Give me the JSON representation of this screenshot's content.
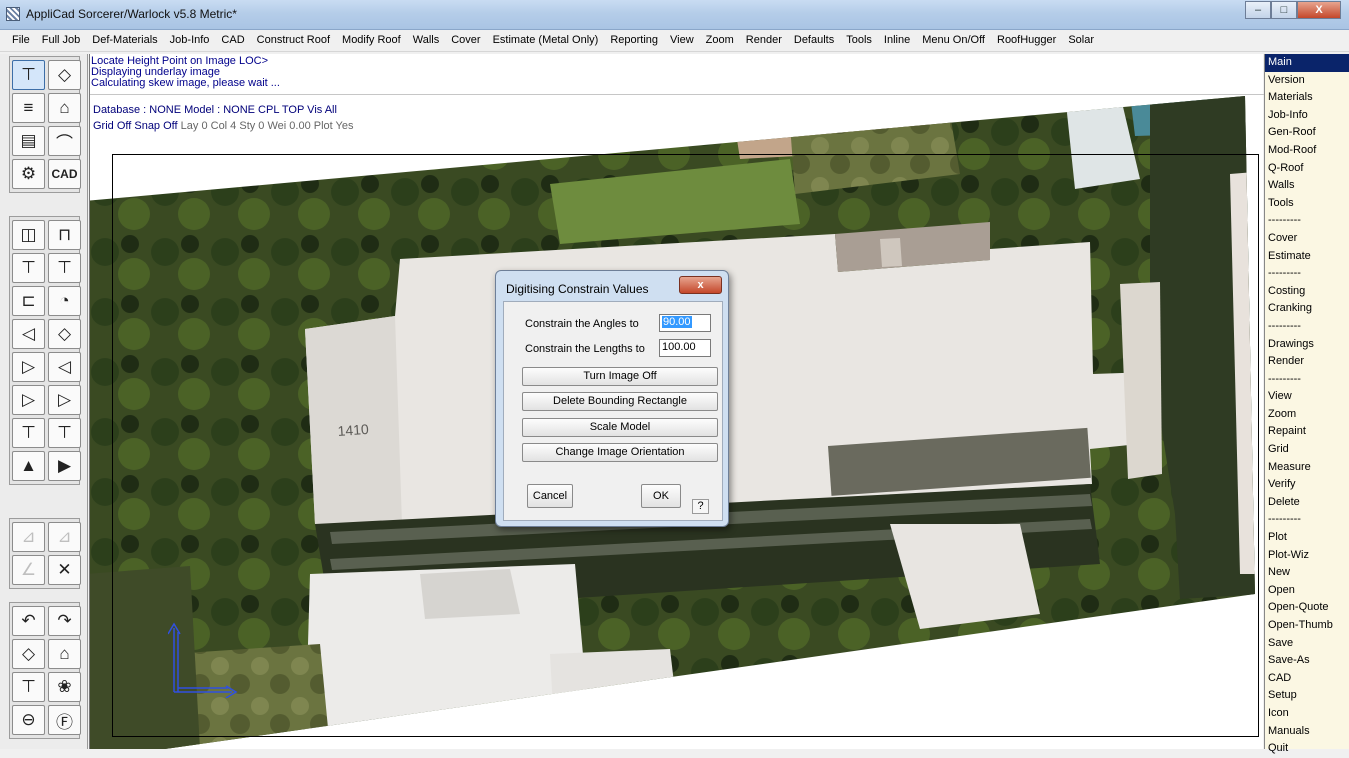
{
  "window": {
    "title": "AppliCad Sorcerer/Warlock v5.8 Metric*",
    "min_icon": "minimize-icon",
    "max_icon": "maximize-icon",
    "close_label": "X"
  },
  "menubar": [
    "File",
    "Full Job",
    "Def-Materials",
    "Job-Info",
    "CAD",
    "Construct Roof",
    "Modify Roof",
    "Walls",
    "Cover",
    "Estimate (Metal Only)",
    "Reporting",
    "View",
    "Zoom",
    "Render",
    "Defaults",
    "Tools",
    "Inline",
    "Menu On/Off",
    "RoofHugger",
    "Solar"
  ],
  "status": {
    "line1": "Locate Height Point on Image LOC>",
    "line2": "Displaying underlay image",
    "line3": "Calculating skew image, please wait ..."
  },
  "info": {
    "line1": "Database : NONE  Model : NONE  CPL TOP  Vis All",
    "grid": "Grid Off  Snap Off",
    "props": "Lay 0   Col 4   Sty 0   Wei 0.00   Plot Yes"
  },
  "toolbar": {
    "cad_label": "CAD",
    "groups": [
      [
        {
          "icon": "roof-plan-icon",
          "sym": "⊤",
          "on": true
        },
        {
          "icon": "roof-3d-icon",
          "sym": "◇"
        },
        {
          "icon": "gable-icon",
          "sym": "≡"
        },
        {
          "icon": "roof-tool-icon",
          "sym": "⌂"
        },
        {
          "icon": "copy-roof-icon",
          "sym": "▤"
        },
        {
          "icon": "hip-icon",
          "sym": "⌒"
        },
        {
          "icon": "wrench-icon",
          "sym": "⚙"
        },
        {
          "icon": "cad-icon",
          "sym": "CAD",
          "text": true
        }
      ],
      [
        {
          "icon": "wall-icon",
          "sym": "◫"
        },
        {
          "icon": "bracket-icon",
          "sym": "⊓"
        },
        {
          "icon": "roof-frame-icon",
          "sym": "⊤"
        },
        {
          "icon": "roof-corner-icon",
          "sym": "⊤"
        },
        {
          "icon": "flashing-icon",
          "sym": "⊏"
        },
        {
          "icon": "dial-icon",
          "sym": "◔"
        },
        {
          "icon": "hip-left-icon",
          "sym": "◁"
        },
        {
          "icon": "diamond-icon",
          "sym": "◇"
        },
        {
          "icon": "sheet-icon",
          "sym": "▷"
        },
        {
          "icon": "fold-icon",
          "sym": "◁"
        },
        {
          "icon": "sheets-left-icon",
          "sym": "▷"
        },
        {
          "icon": "sheets-right-icon",
          "sym": "▷"
        },
        {
          "icon": "frame-icon",
          "sym": "⊤"
        },
        {
          "icon": "truss-icon",
          "sym": "⊤"
        },
        {
          "icon": "stamp-icon",
          "sym": "▲"
        },
        {
          "icon": "ridge-icon",
          "sym": "▶"
        }
      ],
      [
        {
          "icon": "dim-line-icon",
          "sym": "⊿",
          "dim": true
        },
        {
          "icon": "dim-angle-icon",
          "sym": "⊿",
          "dim": true
        },
        {
          "icon": "parallel-icon",
          "sym": "∠",
          "dim": true
        },
        {
          "icon": "delete-x-icon",
          "sym": "✕"
        }
      ],
      [
        {
          "icon": "undo-icon",
          "sym": "↶"
        },
        {
          "icon": "redo-icon",
          "sym": "↷"
        },
        {
          "icon": "roof-view-icon",
          "sym": "◇"
        },
        {
          "icon": "paint-brush-icon",
          "sym": "⌂"
        },
        {
          "icon": "roof-plan2-icon",
          "sym": "⊤"
        },
        {
          "icon": "flower-icon",
          "sym": "❀"
        },
        {
          "icon": "zoom-out-icon",
          "sym": "⊖"
        },
        {
          "icon": "f-circle-icon",
          "sym": "Ⓕ"
        }
      ]
    ]
  },
  "sidebar": [
    "Main",
    "Version",
    "Materials",
    "Job-Info",
    "Gen-Roof",
    "Mod-Roof",
    "Q-Roof",
    "Walls",
    "Tools",
    "---------",
    "Cover",
    "Estimate",
    "---------",
    "Costing",
    "Cranking",
    "---------",
    "Drawings",
    "Render",
    "---------",
    "View",
    "Zoom",
    "Repaint",
    "Grid",
    "Measure",
    "Verify",
    "Delete",
    "---------",
    "Plot",
    "Plot-Wiz",
    "New",
    "Open",
    "Open-Quote",
    "Open-Thumb",
    "Save",
    "Save-As",
    "CAD",
    "Setup",
    "Icon",
    "Manuals",
    "Quit"
  ],
  "dialog": {
    "title": "Digitising Constrain Values",
    "close_label": "x",
    "angles_label": "Constrain the Angles to",
    "angles_value": "90.00",
    "lengths_label": "Constrain the Lengths to",
    "lengths_value": "100.00",
    "btn_turn_off": "Turn Image Off",
    "btn_delete_rect": "Delete Bounding Rectangle",
    "btn_scale": "Scale Model",
    "btn_orientation": "Change Image Orientation",
    "cancel": "Cancel",
    "ok": "OK",
    "help": "?"
  },
  "image": {
    "house_number": "1410"
  },
  "colors": {
    "sidebar_bg": "#fbf7e3",
    "selected": "#0a246a",
    "status_text": "#00008b",
    "axis": "#3050e0"
  }
}
